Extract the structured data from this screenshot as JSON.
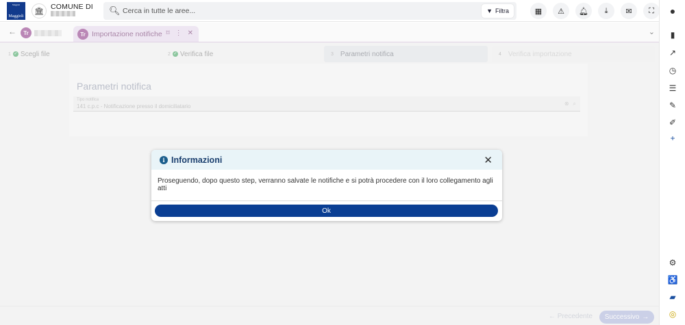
{
  "topbar": {
    "logo_small": "Maggioli",
    "logo_text": "Maggioli",
    "comune_title": "COMUNE DI",
    "search_placeholder": "Cerca in tutte le aree...",
    "filter_label": "Filtra"
  },
  "tabs": {
    "active_label": "Importazione notifiche"
  },
  "stepper": {
    "steps": [
      {
        "num": "1",
        "label": "Scegli file",
        "state": "done"
      },
      {
        "num": "2",
        "label": "Verifica file",
        "state": "done"
      },
      {
        "num": "3",
        "label": "Parametri notifica",
        "state": "active"
      },
      {
        "num": "4",
        "label": "Verifica importazione",
        "state": "disabled"
      }
    ]
  },
  "form": {
    "title": "Parametri notifica",
    "field_label": "Tipo notifica",
    "field_value": "141 c.p.c - Notificazione presso il domiciliatario"
  },
  "footer": {
    "prev_label": "Precedente",
    "next_label": "Successivo"
  },
  "modal": {
    "title": "Informazioni",
    "message": "Proseguendo, dopo questo step, verranno salvate le notifiche e si potrà procedere con il loro collegamento agli atti",
    "ok_label": "Ok"
  },
  "colors": {
    "accent": "#0a3e93",
    "tab_active_bg": "#eadbf0",
    "modal_header_bg": "#e9f4f8"
  }
}
